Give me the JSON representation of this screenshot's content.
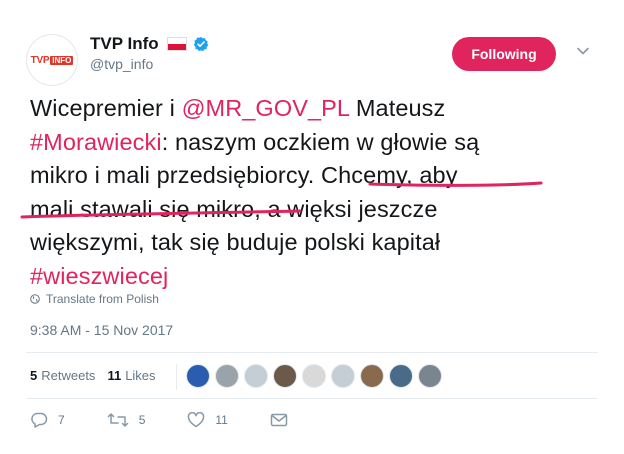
{
  "header": {
    "display_name": "TVP Info",
    "handle": "@tvp_info",
    "avatar_logo": {
      "brand": "TVP",
      "sub": "INFO"
    },
    "follow_button": "Following",
    "flag_icon": "poland-flag-icon",
    "verified_icon": "verified-badge-icon"
  },
  "tweet": {
    "lines": [
      [
        {
          "t": "Wicepremier i ",
          "link": false
        },
        {
          "t": "@MR_GOV_PL",
          "link": true
        },
        {
          "t": " Mateusz",
          "link": false
        }
      ],
      [
        {
          "t": "#Morawiecki",
          "link": true
        },
        {
          "t": ": naszym oczkiem w głowie są",
          "link": false
        }
      ],
      [
        {
          "t": "mikro i mali przedsiębiorcy. Chcemy, aby",
          "link": false
        }
      ],
      [
        {
          "t": "mali stawali się mikro",
          "link": false
        },
        {
          "t": ", a więksi jeszcze",
          "link": false
        }
      ],
      [
        {
          "t": "większymi, tak się buduje polski kapitał",
          "link": false
        }
      ],
      [
        {
          "t": "#wieszwiecej",
          "link": true
        }
      ]
    ],
    "translate": "Translate from Polish",
    "timestamp": "9:38 AM - 15 Nov 2017"
  },
  "stats": {
    "retweets_count": "5",
    "retweets_label": "Retweets",
    "likes_count": "11",
    "likes_label": "Likes"
  },
  "likers": [
    {
      "name": "liker-ps",
      "color": "#2a5db0"
    },
    {
      "name": "liker-2",
      "color": "#9aa3a9"
    },
    {
      "name": "liker-3",
      "color": "#c5ced5"
    },
    {
      "name": "liker-4",
      "color": "#6b5a4a"
    },
    {
      "name": "liker-5",
      "color": "#d9d9d9"
    },
    {
      "name": "liker-6",
      "color": "#c5ced5"
    },
    {
      "name": "liker-7",
      "color": "#8a6a4d"
    },
    {
      "name": "liker-8",
      "color": "#4a6a8a"
    },
    {
      "name": "liker-9",
      "color": "#7a8590"
    }
  ],
  "actions": {
    "replies": "7",
    "retweets": "5",
    "likes": "11"
  },
  "colors": {
    "accent": "#e0245e",
    "underline": "#e0245e",
    "secondary_text": "#657786"
  }
}
